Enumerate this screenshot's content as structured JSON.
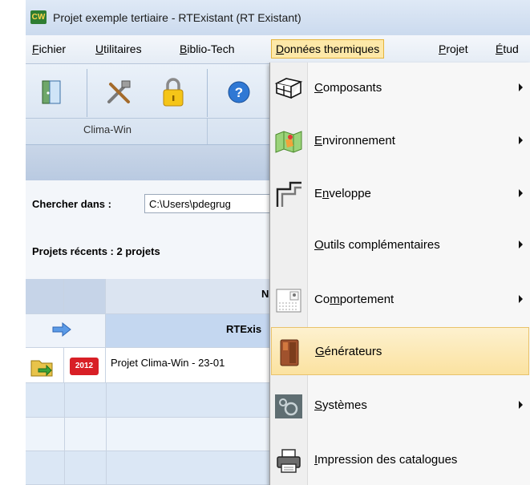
{
  "window": {
    "app_icon": "CW",
    "title": "Projet exemple tertiaire - RTExistant (RT Existant)"
  },
  "menubar": {
    "items": [
      {
        "label": "Fichier"
      },
      {
        "label": "Utilitaires"
      },
      {
        "label": "Biblio-Tech"
      },
      {
        "label": "Données thermiques",
        "active": true
      },
      {
        "label": "Projet"
      },
      {
        "label": "Étud"
      }
    ]
  },
  "toolbar": {
    "buttons": [
      {
        "icon": "door-icon"
      },
      {
        "icon": "tools-icon"
      },
      {
        "icon": "lock-icon"
      },
      {
        "icon": "help-icon"
      }
    ],
    "group_label": "Clima-Win"
  },
  "search": {
    "label": "Chercher dans :",
    "path": "C:\\Users\\pdegrug"
  },
  "recent": {
    "label": "Projets récents : 2 projets"
  },
  "grid": {
    "header_n": "N",
    "group_header": "RTExis",
    "rows": [
      {
        "badge": "2012",
        "name": "Projet Clima-Win - 23-01"
      }
    ]
  },
  "dropdown": {
    "items": [
      {
        "label": "Composants",
        "mnemonic": "C",
        "submenu": true,
        "icon": "components-icon"
      },
      {
        "label": "Environnement",
        "mnemonic": "E",
        "submenu": true,
        "icon": "map-icon"
      },
      {
        "label": "Enveloppe",
        "mnemonic": "n",
        "submenu": true,
        "icon": "envelope-icon"
      },
      {
        "label": "Outils complémentaires",
        "mnemonic": "O",
        "submenu": true,
        "icon": ""
      },
      {
        "label": "Comportement",
        "mnemonic": "m",
        "submenu": true,
        "icon": "schedule-icon"
      },
      {
        "label": "Générateurs",
        "mnemonic": "G",
        "submenu": false,
        "icon": "boiler-icon",
        "highlighted": true
      },
      {
        "label": "Systèmes",
        "mnemonic": "S",
        "submenu": true,
        "icon": "systems-icon"
      },
      {
        "label": "Impression des catalogues",
        "mnemonic": "I",
        "submenu": false,
        "icon": "printer-icon"
      }
    ]
  },
  "colors": {
    "highlight": "#fbe2a0",
    "accent": "#4a8ee8"
  }
}
